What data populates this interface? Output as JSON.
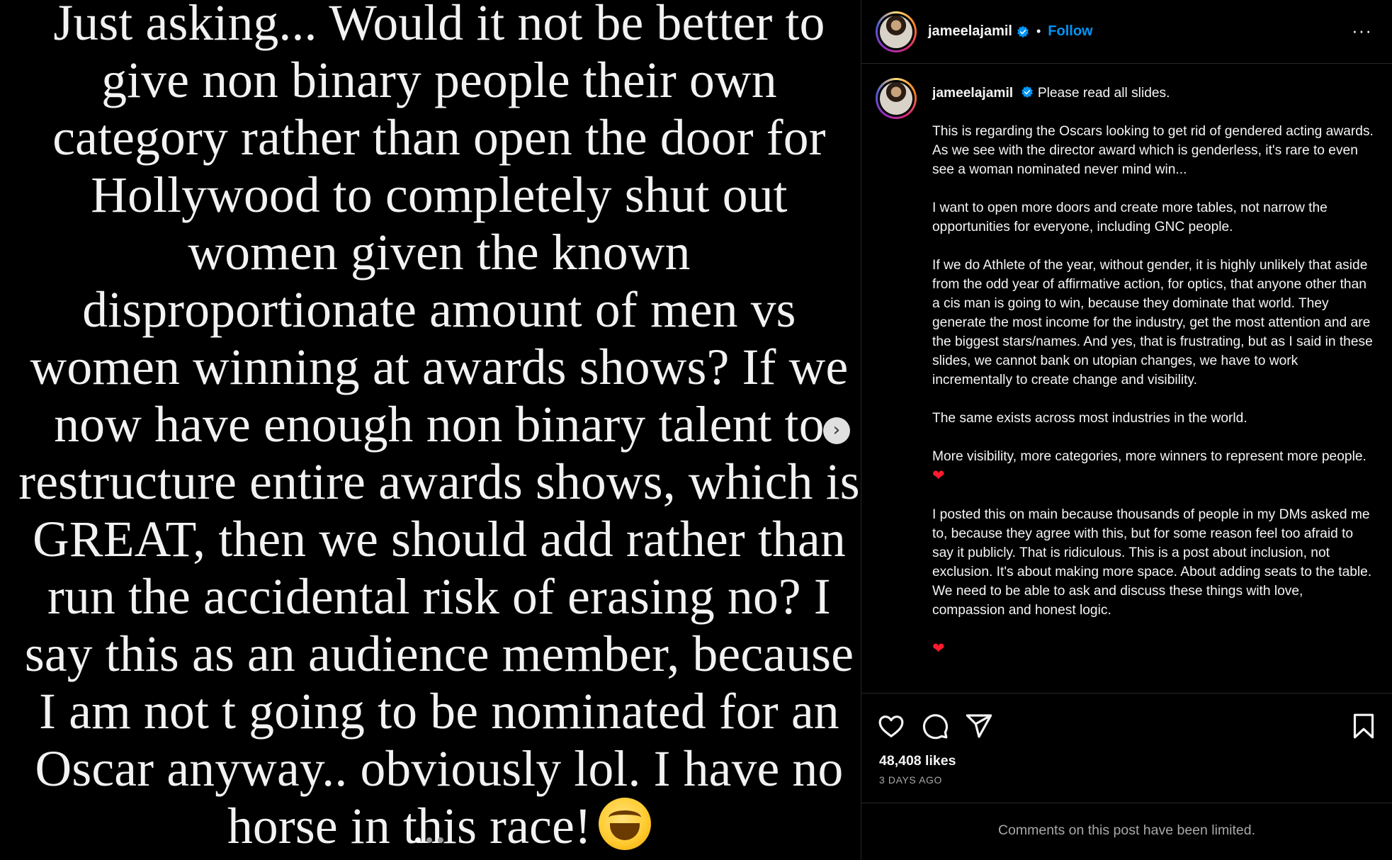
{
  "media": {
    "lines": [
      "Just asking... Would it not be better to",
      "give non binary people their own",
      "category rather than open the door for",
      "Hollywood to completely shut out",
      "women given the known",
      "disproportionate amount of men vs",
      "women winning at awards shows? If we",
      "now have enough non binary talent to",
      "restructure entire awards shows, which is",
      "GREAT, then we should add rather than",
      "run the accidental risk of erasing no? I",
      "say this as an audience member, because",
      "I am not t going to be nominated for an",
      "Oscar anyway.. obviously lol. I have no",
      "horse in this race!"
    ],
    "emoji_icon": "face-with-tears-of-joy-emoji",
    "next_icon": "chevron-right-icon",
    "next_glyph": "›",
    "carousel_dots": 3,
    "active_dot": 0
  },
  "header": {
    "username": "jameelajamil",
    "separator": "•",
    "follow_label": "Follow",
    "more_glyph": "···"
  },
  "caption": {
    "username": "jameelajamil",
    "first_line": "Please read all slides.",
    "paragraphs": [
      "This is regarding the Oscars looking to get rid of gendered acting awards. As we see with the director award which is genderless, it's rare to even see a woman nominated never mind win...",
      "I want to open more doors and create more tables, not narrow the opportunities for everyone, including GNC people.",
      "If we do Athlete of the year, without gender, it is highly unlikely that aside from the odd year of affirmative action, for optics, that anyone other than a cis man is going to win, because they dominate that world. They generate the most income for the industry, get the most attention and are the biggest stars/names. And yes, that is frustrating, but as I said in these slides, we cannot bank on utopian changes, we have to work incrementally to create change and visibility.",
      "The same exists across most industries in the world.",
      "More visibility, more categories, more winners to represent more people.",
      "I posted this on main because thousands of people in my DMs asked me to, because they agree with this, but for some reason feel too afraid to say it publicly. That is ridiculous. This is a post about inclusion, not exclusion. It's about making more space. About adding seats to the table. We need to be able to ask and discuss these things with love, compassion and honest logic."
    ],
    "heart_glyph": "❤"
  },
  "actions": {
    "likes": "48,408 likes",
    "time": "3 DAYS AGO",
    "comments_note": "Comments on this post have been limited."
  },
  "colors": {
    "accent": "#0095f6",
    "verified": "#0095f6",
    "heart": "#ff1a2e",
    "border": "#262626"
  }
}
